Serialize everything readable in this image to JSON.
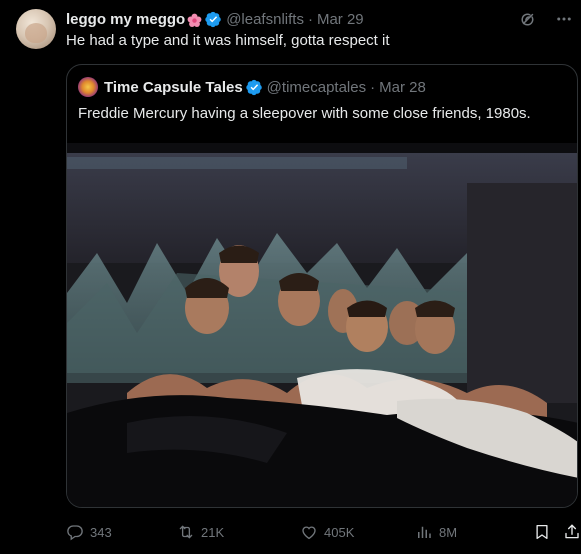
{
  "tweet": {
    "author_name": "leggo my meggo",
    "author_emoji": "flower-emoji",
    "verified": true,
    "handle": "@leafsnlifts",
    "separator": "·",
    "date": "Mar 29",
    "text": "He had a type and it was himself, gotta respect it"
  },
  "quote": {
    "author_name": "Time Capsule Tales",
    "verified": true,
    "handle": "@timecaptales",
    "separator": "·",
    "date": "Mar 28",
    "text": "Freddie Mercury having a sleepover with some close friends, 1980s."
  },
  "actions": {
    "replies": "343",
    "reposts": "21K",
    "likes": "405K",
    "views": "8M"
  },
  "icons": {
    "grok": "grok-icon",
    "more": "more-icon",
    "reply": "reply-icon",
    "repost": "repost-icon",
    "like": "heart-icon",
    "views": "views-icon",
    "bookmark": "bookmark-icon",
    "share": "share-icon"
  },
  "colors": {
    "background": "#000000",
    "text": "#e7e9ea",
    "muted": "#71767b",
    "verified": "#1d9bf0",
    "border": "#2f3336"
  }
}
